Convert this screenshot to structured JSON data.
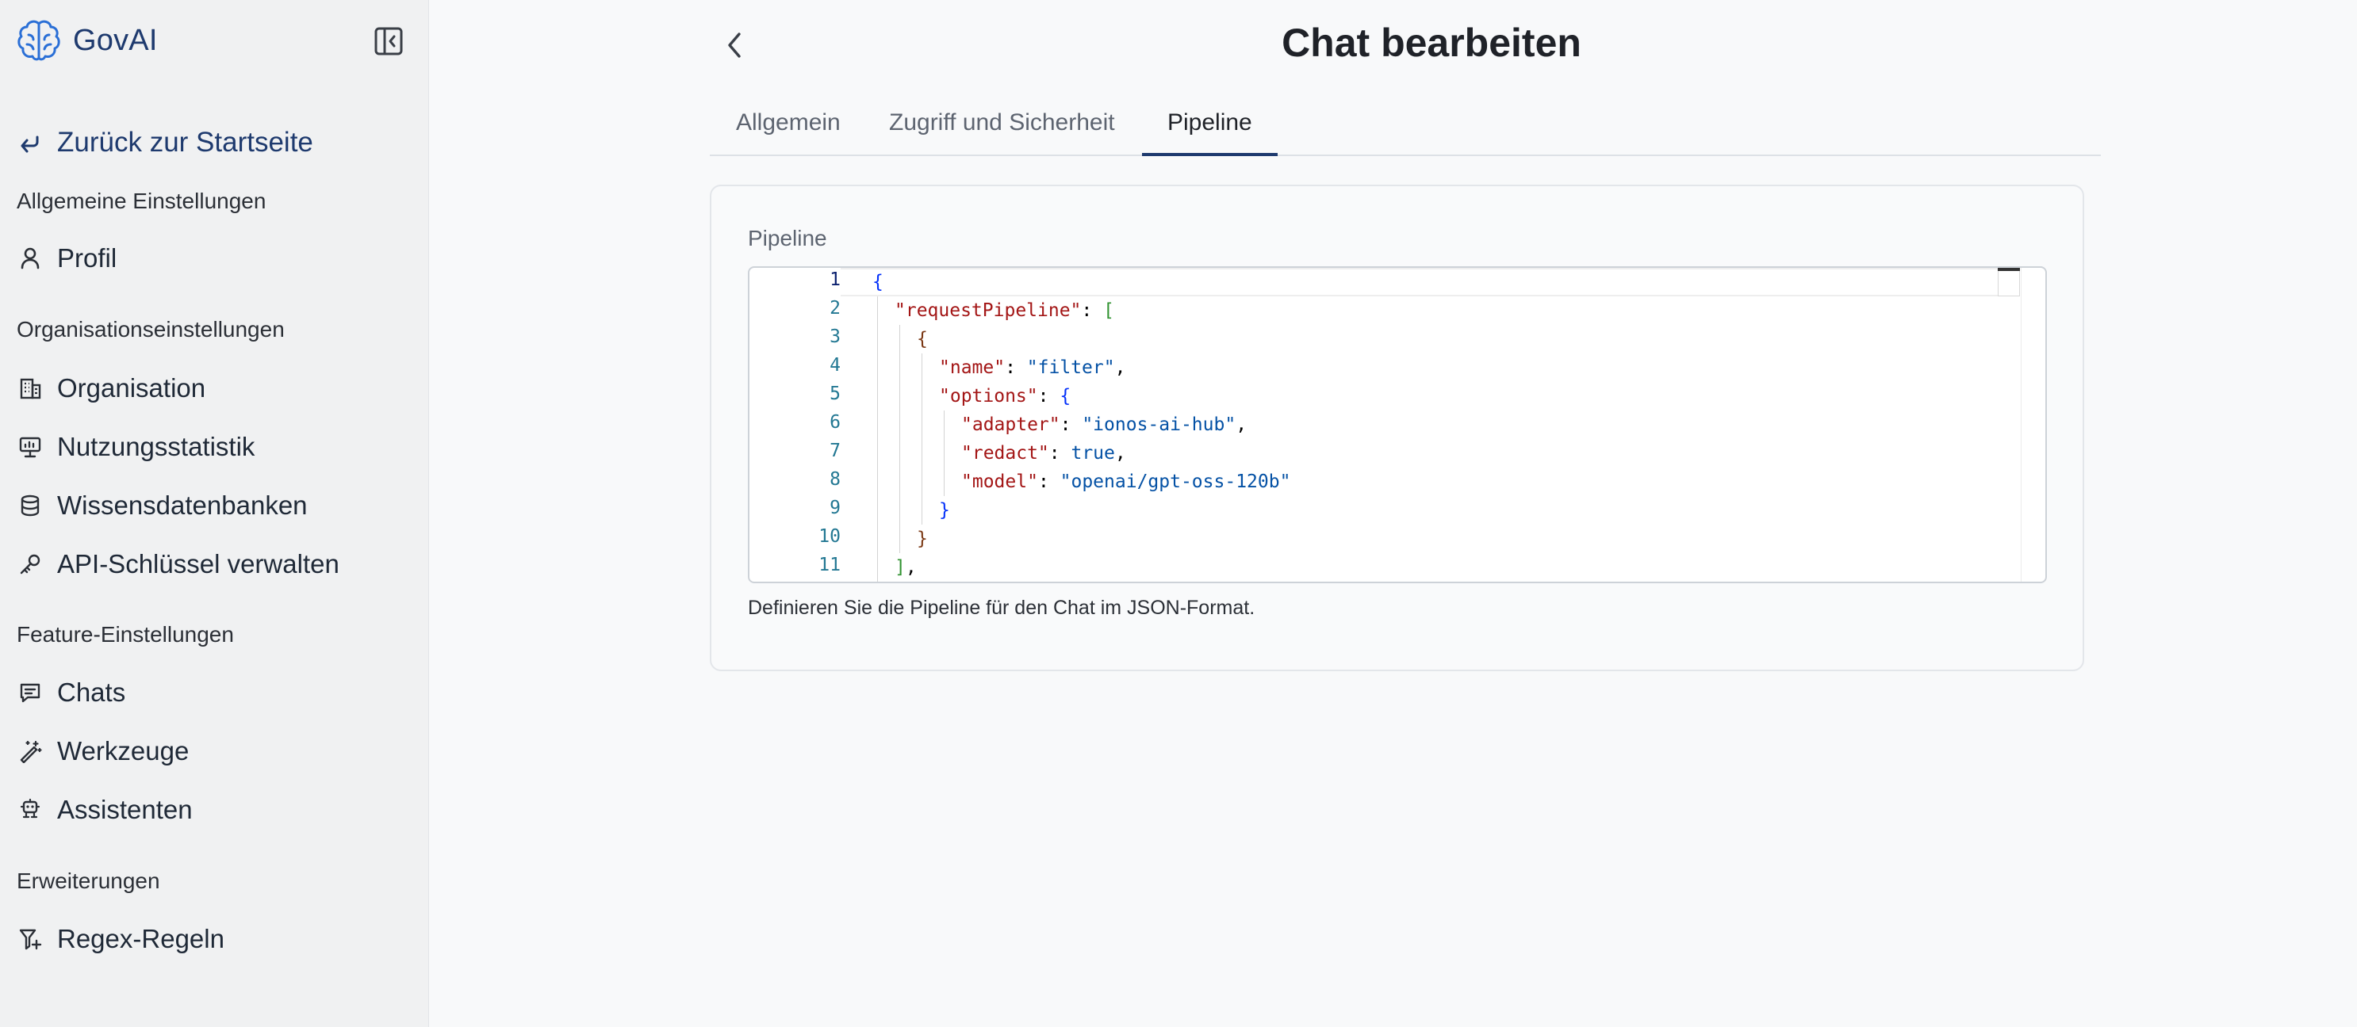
{
  "brand": {
    "name": "GovAI"
  },
  "sidebar": {
    "back_label": "Zurück zur Startseite",
    "sections": [
      {
        "title": "Allgemeine Einstellungen",
        "items": [
          {
            "label": "Profil",
            "icon": "user-icon"
          }
        ]
      },
      {
        "title": "Organisationseinstellungen",
        "items": [
          {
            "label": "Organisation",
            "icon": "building-icon"
          },
          {
            "label": "Nutzungsstatistik",
            "icon": "presentation-chart-icon"
          },
          {
            "label": "Wissensdatenbanken",
            "icon": "database-icon"
          },
          {
            "label": "API-Schlüssel verwalten",
            "icon": "key-icon"
          }
        ]
      },
      {
        "title": "Feature-Einstellungen",
        "items": [
          {
            "label": "Chats",
            "icon": "chat-icon"
          },
          {
            "label": "Werkzeuge",
            "icon": "magic-wand-icon"
          },
          {
            "label": "Assistenten",
            "icon": "robot-icon"
          }
        ]
      },
      {
        "title": "Erweiterungen",
        "items": [
          {
            "label": "Regex-Regeln",
            "icon": "filter-plus-icon"
          }
        ]
      }
    ]
  },
  "header": {
    "title": "Chat bearbeiten"
  },
  "tabs": [
    {
      "label": "Allgemein",
      "active": false
    },
    {
      "label": "Zugriff und Sicherheit",
      "active": false
    },
    {
      "label": "Pipeline",
      "active": true
    }
  ],
  "pipeline": {
    "label": "Pipeline",
    "helper": "Definieren Sie die Pipeline für den Chat im JSON-Format.",
    "line_numbers": [
      "1",
      "2",
      "3",
      "4",
      "5",
      "6",
      "7",
      "8",
      "9",
      "10",
      "11"
    ],
    "active_line": "1",
    "code": {
      "l1_brace": "{",
      "l2_key": "\"requestPipeline\"",
      "l2_colon": ": ",
      "l2_bracket": "[",
      "l3_brace": "{",
      "l4_key": "\"name\"",
      "l4_colon": ": ",
      "l4_val": "\"filter\"",
      "l4_comma": ",",
      "l5_key": "\"options\"",
      "l5_colon": ": ",
      "l5_brace": "{",
      "l6_key": "\"adapter\"",
      "l6_colon": ": ",
      "l6_val": "\"ionos-ai-hub\"",
      "l6_comma": ",",
      "l7_key": "\"redact\"",
      "l7_colon": ": ",
      "l7_val": "true",
      "l7_comma": ",",
      "l8_key": "\"model\"",
      "l8_colon": ": ",
      "l8_val": "\"openai/gpt-oss-120b\"",
      "l9_brace": "}",
      "l10_brace": "}",
      "l11_bracket": "]",
      "l11_comma": ","
    }
  },
  "colors": {
    "accent": "#1e3a6e",
    "sidebar_bg": "#f0f1f2",
    "page_bg": "#f8f9fa"
  }
}
